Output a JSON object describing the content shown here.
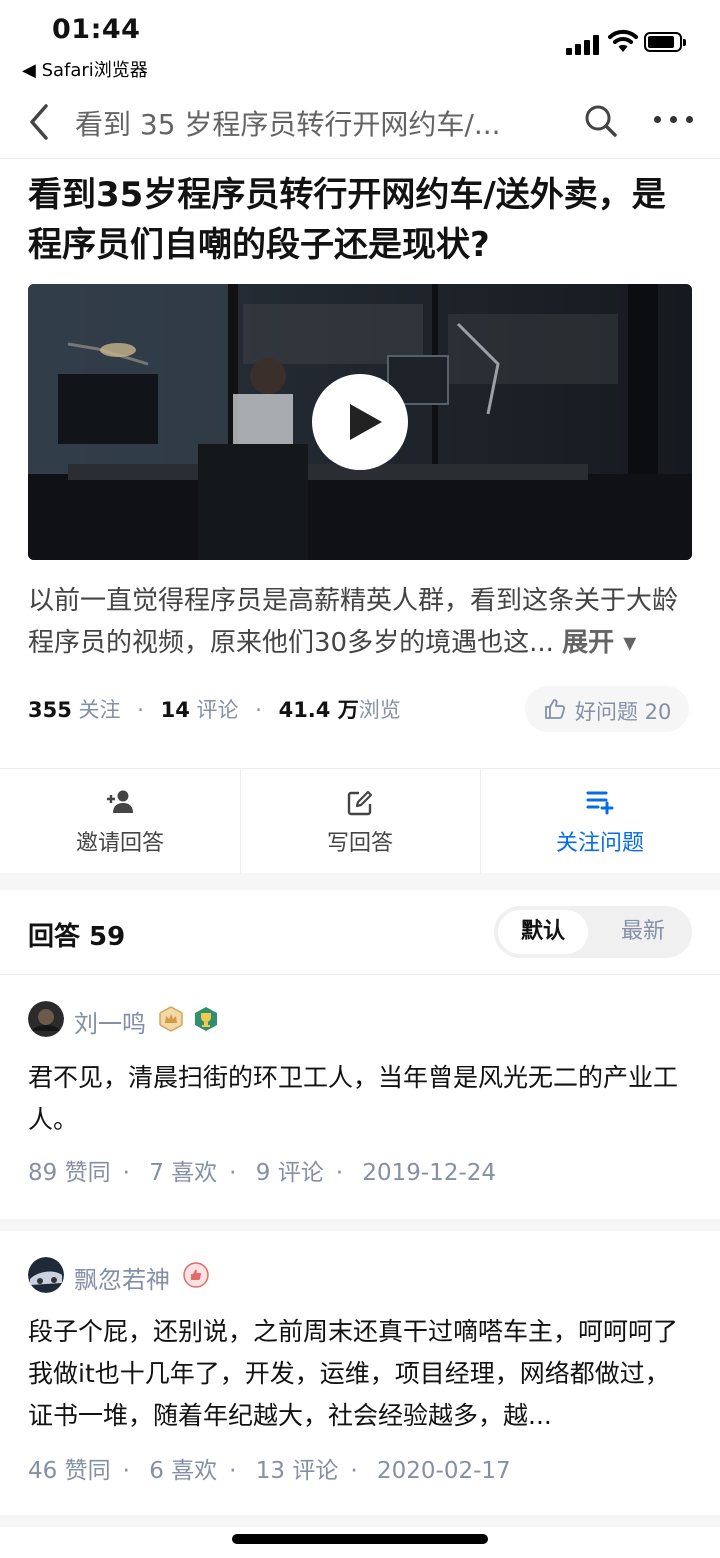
{
  "status_bar": {
    "time": "01:44",
    "back_app": "◀ Safari浏览器"
  },
  "nav": {
    "title": "看到 35 岁程序员转行开网约车/...",
    "icons": [
      "back-chevron-icon",
      "search-icon",
      "more-icon"
    ]
  },
  "question": {
    "title": "看到35岁程序员转行开网约车/送外卖，是程序员们自嘲的段子还是现状?",
    "description": "以前一直觉得程序员是高薪精英人群，看到这条关于大龄程序员的视频，原来他们30多岁的境遇也这...",
    "expand_label": "展开 ▾",
    "stats": {
      "followers": "355",
      "followers_label": "关注",
      "comments": "14",
      "comments_label": "评论",
      "views": "41.4 万",
      "views_label": "浏览"
    },
    "good_question": "好问题 20"
  },
  "actions": [
    {
      "label": "邀请回答",
      "icon": "add-user-icon"
    },
    {
      "label": "写回答",
      "icon": "edit-icon"
    },
    {
      "label": "关注问题",
      "icon": "add-list-icon",
      "active": true
    }
  ],
  "answers_header": {
    "count": "回答 59",
    "sort_options": [
      "默认",
      "最新"
    ],
    "selected": "默认"
  },
  "answers": [
    {
      "author": "刘一鸣",
      "text": "君不见，清晨扫街的环卫工人，当年曾是风光无二的产业工人。",
      "likes": "89 赞同",
      "favorites": "7 喜欢",
      "comments": "9 评论",
      "date": "2019-12-24"
    },
    {
      "author": "飘忽若神",
      "text": "段子个屁，还别说，之前周末还真干过嘀嗒车主，呵呵呵了 我做it也十几年了，开发，运维，项目经理，网络都做过，证书一堆，随着年纪越大，社会经验越多，越...",
      "likes": "46 赞同",
      "favorites": "6 喜欢",
      "comments": "13 评论",
      "date": "2020-02-17"
    }
  ],
  "colors": {
    "accent": "#056de8",
    "muted": "#8590a6",
    "divider": "#f6f6f6"
  }
}
